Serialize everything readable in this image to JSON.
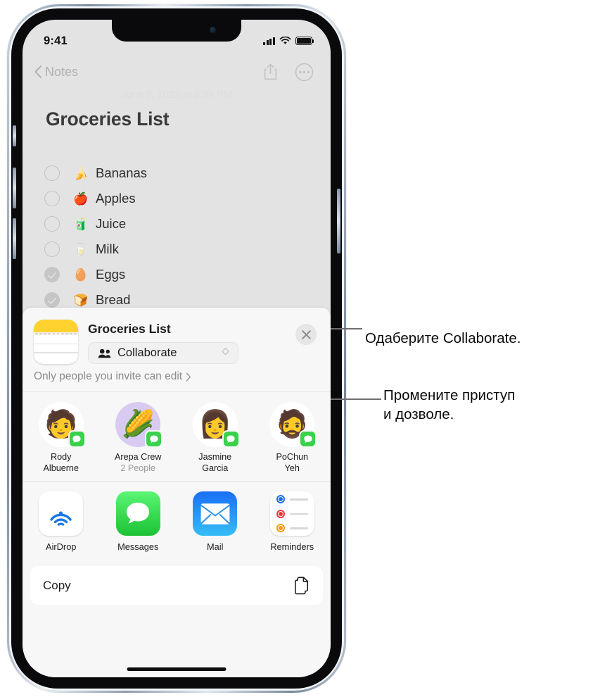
{
  "status_bar": {
    "time": "9:41",
    "signal_icon": "cellular-bars-icon",
    "wifi_icon": "wifi-icon",
    "battery_icon": "battery-icon"
  },
  "nav_bar": {
    "back_label": "Notes",
    "back_icon": "chevron-left-icon",
    "share_icon": "share-up-arrow-icon",
    "more_icon": "ellipsis-circle-icon"
  },
  "note": {
    "date": "June 8, 2022 at 8:39 PM",
    "title": "Groceries List",
    "items": [
      {
        "label": "Bananas",
        "emoji": "🍌",
        "checked": false
      },
      {
        "label": "Apples",
        "emoji": "🍎",
        "checked": false
      },
      {
        "label": "Juice",
        "emoji": "🧃",
        "checked": false
      },
      {
        "label": "Milk",
        "emoji": "🥛",
        "checked": false
      },
      {
        "label": "Eggs",
        "emoji": "🥚",
        "checked": true
      },
      {
        "label": "Bread",
        "emoji": "🍞",
        "checked": true
      }
    ]
  },
  "share_sheet": {
    "app_icon": "notes-app-icon",
    "title": "Groceries List",
    "collaborate": {
      "label": "Collaborate",
      "people_icon": "two-people-icon",
      "selector_icon": "up-down-chevron-icon"
    },
    "permission_text": "Only people you invite can edit",
    "permission_chevron": "chevron-right-icon",
    "close_icon": "close-x-icon",
    "contacts": [
      {
        "name": "Rody\nAlbuerne",
        "sub": "",
        "emoji": "🧑",
        "bg": "white",
        "badge": "messages-badge-icon"
      },
      {
        "name": "Arepa Crew",
        "sub": "2 People",
        "emoji": "🌽",
        "bg": "purple",
        "badge": "messages-badge-icon"
      },
      {
        "name": "Jasmine\nGarcia",
        "sub": "",
        "emoji": "👩",
        "bg": "white",
        "badge": "messages-badge-icon"
      },
      {
        "name": "PoChun\nYeh",
        "sub": "",
        "emoji": "🧔",
        "bg": "white",
        "badge": "messages-badge-icon"
      }
    ],
    "apps": [
      {
        "label": "AirDrop",
        "icon": "airdrop-icon"
      },
      {
        "label": "Messages",
        "icon": "messages-icon"
      },
      {
        "label": "Mail",
        "icon": "mail-icon"
      },
      {
        "label": "Reminders",
        "icon": "reminders-icon"
      }
    ],
    "actions": [
      {
        "label": "Copy",
        "icon": "copy-documents-icon"
      }
    ]
  },
  "callouts": [
    {
      "text": "Одаберите Collaborate."
    },
    {
      "text": "Промените приступ\nи дозволе."
    }
  ],
  "colors": {
    "messages_green": "#3ad14b",
    "notes_yellow": "#ffd230",
    "mail_blue": "#1a6ef5",
    "airdrop_blue": "#1577e8",
    "reminder_blue": "#1f6fe5",
    "reminder_red": "#f0343c",
    "reminder_orange": "#fa9a17",
    "screen_bg": "#e3e3e3",
    "sheet_bg": "#f7f7f7"
  }
}
